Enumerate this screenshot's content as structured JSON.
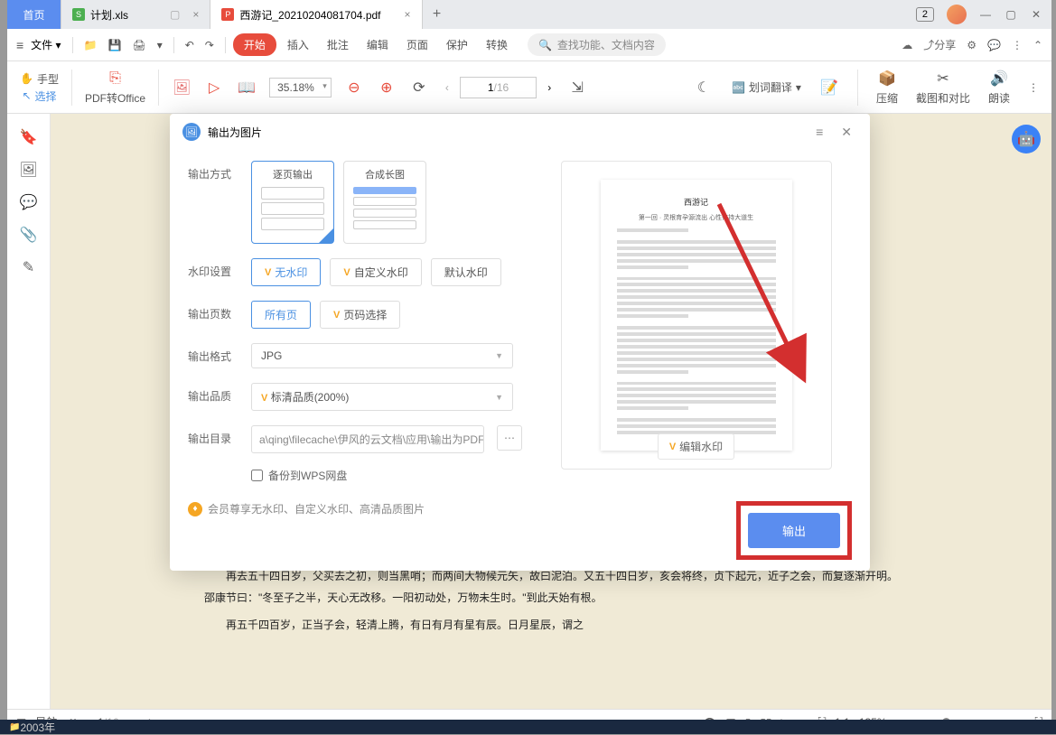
{
  "tabs": {
    "home": "首页",
    "t1": "计划.xls",
    "t2": "西游记_20210204081704.pdf"
  },
  "titlebar": {
    "counter": "2"
  },
  "menubar": {
    "file": "文件",
    "start": "开始",
    "insert": "插入",
    "annotate": "批注",
    "edit": "编辑",
    "page": "页面",
    "protect": "保护",
    "convert": "转换",
    "search": "查找功能、文档内容",
    "share": "分享"
  },
  "ribbon": {
    "hand": "手型",
    "select": "选择",
    "pdf2office": "PDF转Office",
    "zoom": "35.18%",
    "pageCur": "1",
    "pageSep": "/",
    "pageTotal": "16",
    "translate": "划词翻译",
    "compress": "压缩",
    "screenshot": "截图和对比",
    "read": "朗读"
  },
  "doc": {
    "p1": "再去五十四日岁，父买去之初，则当黑哨；而两间大物候元矢，故曰泥泊。又五十四日岁，亥会将终，贞下起元，近子之会，而复逐渐开明。邵康节曰：\"冬至子之半，天心无改移。一阳初动处，万物未生时。\"到此天始有根。",
    "p2": "再五千四百岁，正当子会，轻清上腾，有日有月有星有辰。日月星辰，谓之"
  },
  "dialog": {
    "title": "输出为图片",
    "labels": {
      "mode": "输出方式",
      "watermark": "水印设置",
      "pages": "输出页数",
      "format": "输出格式",
      "quality": "输出品质",
      "dir": "输出目录"
    },
    "mode": {
      "perPage": "逐页输出",
      "merge": "合成长图"
    },
    "wm": {
      "none": "无水印",
      "custom": "自定义水印",
      "default": "默认水印"
    },
    "pages": {
      "all": "所有页",
      "select": "页码选择"
    },
    "format": "JPG",
    "quality": "标清品质(200%)",
    "path": "a\\qing\\filecache\\伊风的云文档\\应用\\输出为PDF\\",
    "backup": "备份到WPS网盘",
    "vip": "会员尊享无水印、自定义水印、高清品质图片",
    "editWm": "编辑水印",
    "export": "输出",
    "previewTitle": "西游记",
    "previewSub": "第一回 · 灵根育孕源流出 心性修持大道生"
  },
  "status": {
    "nav": "导航",
    "pg": "1",
    "sep": "/",
    "tot": "16",
    "zoom": "135%"
  },
  "task": "2003年"
}
